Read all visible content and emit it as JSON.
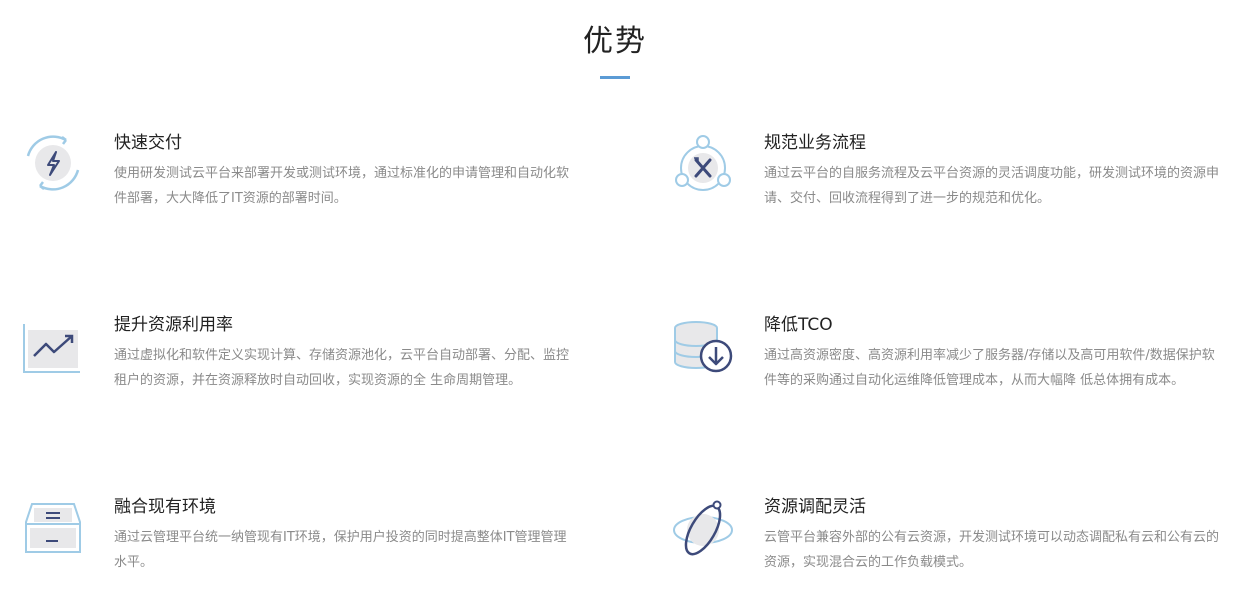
{
  "section": {
    "title": "优势"
  },
  "items": [
    {
      "title": "快速交付",
      "desc": "使用研发测试云平台来部署开发或测试环境，通过标准化的申请管理和自动化软件部署，大大降低了IT资源的部署时间。",
      "icon": "lightning-icon"
    },
    {
      "title": "规范业务流程",
      "desc": "通过云平台的自服务流程及云平台资源的灵活调度功能，研发测试环境的资源申请、交付、回收流程得到了进一步的规范和优化。",
      "icon": "tools-network-icon"
    },
    {
      "title": "提升资源利用率",
      "desc": "通过虚拟化和软件定义实现计算、存储资源池化，云平台自动部署、分配、监控租户的资源，并在资源释放时自动回收，实现资源的全 生命周期管理。",
      "icon": "trend-chart-icon"
    },
    {
      "title": "降低TCO",
      "desc": "通过高资源密度、高资源利用率减少了服务器/存储以及高可用软件/数据保护软件等的采购通过自动化运维降低管理成本，从而大幅降 低总体拥有成本。",
      "icon": "database-download-icon"
    },
    {
      "title": "融合现有环境",
      "desc": "通过云管理平台统一纳管现有IT环境，保护用户投资的同时提高整体IT管理管理水平。",
      "icon": "storage-tray-icon"
    },
    {
      "title": "资源调配灵活",
      "desc": "云管平台兼容外部的公有云资源，开发测试环境可以动态调配私有云和公有云的资源，实现混合云的工作负载模式。",
      "icon": "orbit-icon"
    }
  ],
  "colors": {
    "accent": "#5b9bd5",
    "icon_light": "#9fcbe6",
    "icon_dark": "#3d4a7a",
    "icon_fill": "#e8e8ea"
  }
}
